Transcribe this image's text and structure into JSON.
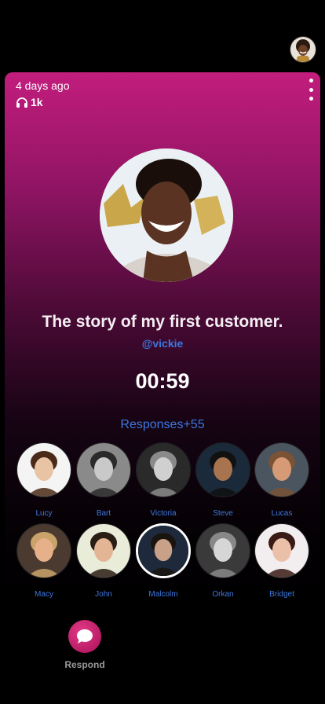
{
  "header": {
    "avatar_icon": "user-avatar"
  },
  "post": {
    "time_ago": "4 days ago",
    "listens": "1k",
    "title": "The story of my first customer.",
    "handle": "@vickie",
    "duration": "00:59"
  },
  "responses": {
    "label": "Responses+55",
    "people": [
      {
        "name": "Lucy",
        "skin": "#e8c3a4",
        "hair": "#4a2a18",
        "bg": "#f4f4f4"
      },
      {
        "name": "Bart",
        "skin": "#c9c9c9",
        "hair": "#2a2a2a",
        "bg": "#8a8a8a"
      },
      {
        "name": "Victoria",
        "skin": "#d0d0d0",
        "hair": "#8a8a8a",
        "bg": "#2a2a2a"
      },
      {
        "name": "Steve",
        "skin": "#a87450",
        "hair": "#111111",
        "bg": "#1a2a3a"
      },
      {
        "name": "Lucas",
        "skin": "#d79a76",
        "hair": "#7a5236",
        "bg": "#4a5560"
      },
      {
        "name": "Macy",
        "skin": "#e6b08a",
        "hair": "#c9a36a",
        "bg": "#4a3a30"
      },
      {
        "name": "John",
        "skin": "#e3b594",
        "hair": "#2a1d14",
        "bg": "#e8ecd8"
      },
      {
        "name": "Malcolm",
        "skin": "#c9a088",
        "hair": "#1a1410",
        "bg": "#1e2a3c"
      },
      {
        "name": "Orkan",
        "skin": "#d6d6d6",
        "hair": "#888888",
        "bg": "#3a3a3a"
      },
      {
        "name": "Bridget",
        "skin": "#eac0a8",
        "hair": "#3a1a14",
        "bg": "#f2eef0"
      }
    ]
  },
  "footer": {
    "respond_label": "Respond"
  },
  "colors": {
    "accent": "#3d78e0",
    "brand": "#c21d7d"
  }
}
